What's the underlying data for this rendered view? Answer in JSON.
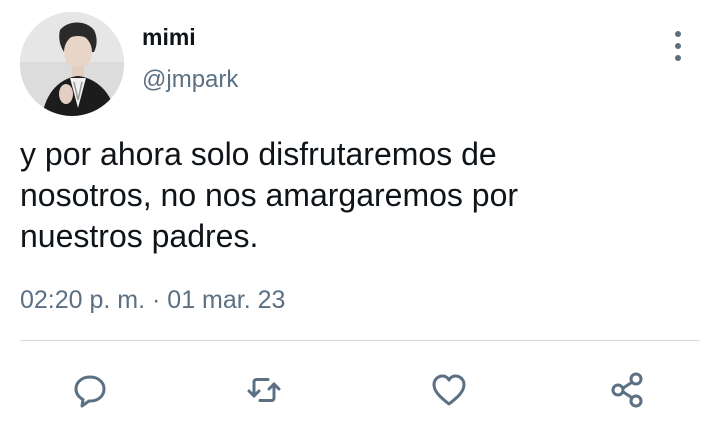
{
  "author": {
    "display_name": "mimi",
    "handle": "@jmpark"
  },
  "tweet": {
    "text": "y por ahora solo disfrutaremos de\nnosotros, no nos amargaremos por\nnuestros padres.",
    "timestamp": "02:20 p. m. · 01 mar. 23"
  },
  "icons": {
    "more": "more-vertical-icon",
    "reply": "reply-icon",
    "retweet": "retweet-icon",
    "like": "heart-icon",
    "share": "share-icon"
  },
  "colors": {
    "text": "#0f1419",
    "secondary": "#5b7083",
    "divider": "#cfd9de",
    "background": "#ffffff"
  }
}
